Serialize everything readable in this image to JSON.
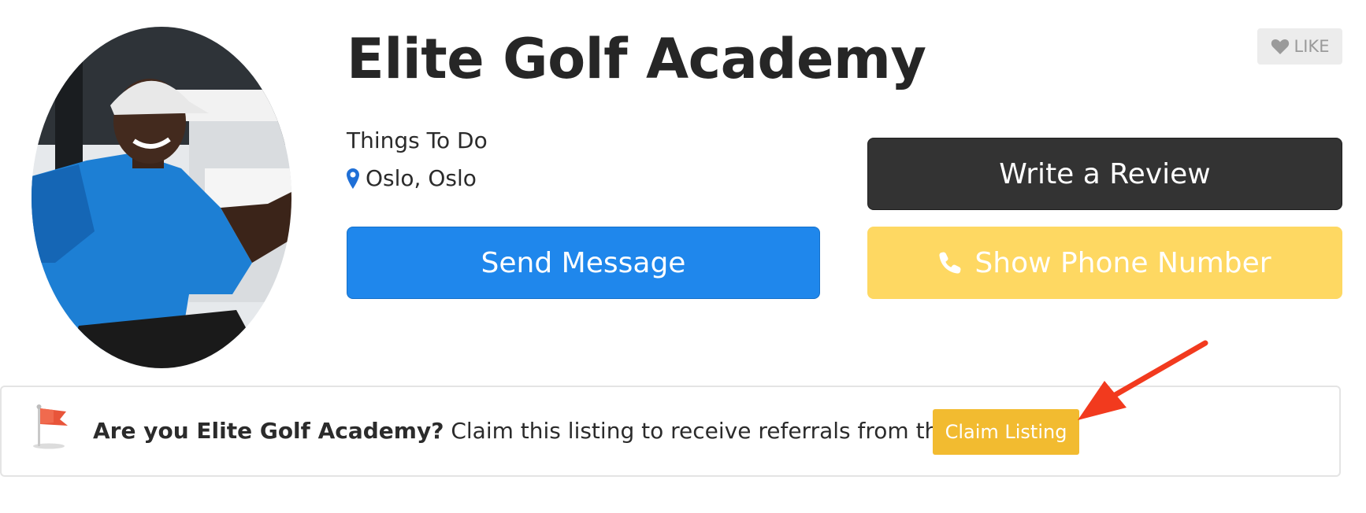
{
  "listing": {
    "title": "Elite Golf Academy",
    "category": "Things To Do",
    "location": "Oslo, Oslo"
  },
  "like": {
    "label": "LIKE",
    "icon": "heart-icon"
  },
  "buttons": {
    "write_review": "Write a Review",
    "send_message": "Send Message",
    "show_phone": "Show Phone Number"
  },
  "claim": {
    "question": "Are you Elite Golf Academy?",
    "message": " Claim this listing to receive referrals from this page.",
    "button": "Claim Listing"
  },
  "colors": {
    "send_message": "#1f87ec",
    "write_review": "#333333",
    "show_phone": "#fed862",
    "claim_button": "#f2bb30",
    "annotation_arrow": "#f23a1e"
  }
}
